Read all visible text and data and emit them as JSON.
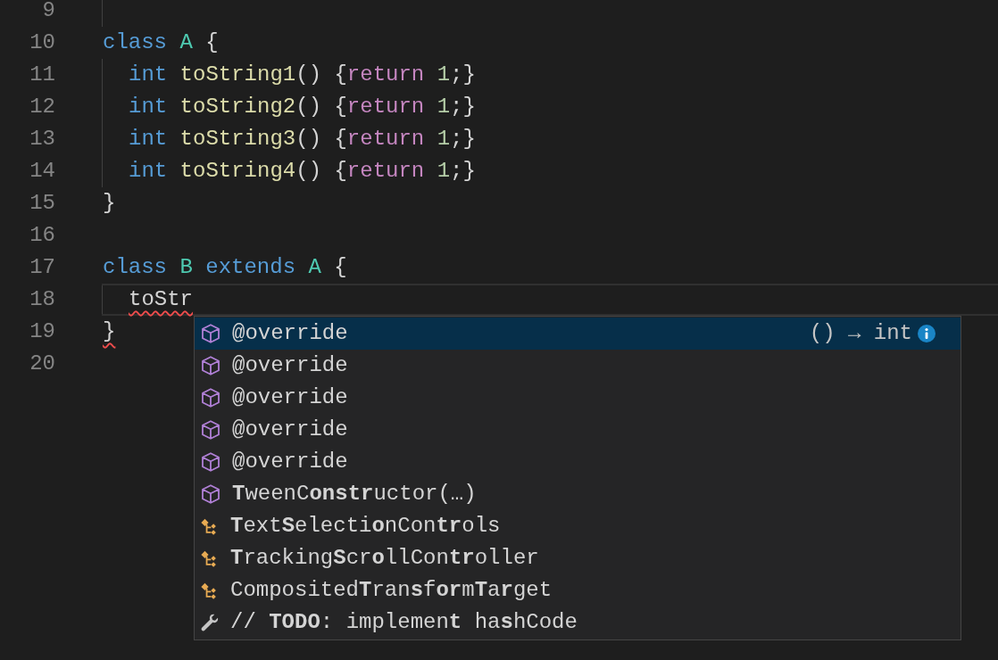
{
  "editor": {
    "lines": [
      {
        "number": "9",
        "guide": true,
        "current": false
      },
      {
        "number": "10",
        "guide": false,
        "current": false,
        "indented": false,
        "tokens": [
          {
            "text": "class ",
            "kind": "keyword"
          },
          {
            "text": "A",
            "kind": "type"
          },
          {
            "text": " {",
            "kind": "plain"
          }
        ]
      },
      {
        "number": "11",
        "guide": true,
        "current": false,
        "indented": true,
        "tokens": [
          {
            "text": "int ",
            "kind": "keyword"
          },
          {
            "text": "toString1",
            "kind": "function"
          },
          {
            "text": "() {",
            "kind": "plain"
          },
          {
            "text": "return ",
            "kind": "control"
          },
          {
            "text": "1",
            "kind": "number"
          },
          {
            "text": ";}",
            "kind": "plain"
          }
        ]
      },
      {
        "number": "12",
        "guide": true,
        "current": false,
        "indented": true,
        "tokens": [
          {
            "text": "int ",
            "kind": "keyword"
          },
          {
            "text": "toString2",
            "kind": "function"
          },
          {
            "text": "() {",
            "kind": "plain"
          },
          {
            "text": "return ",
            "kind": "control"
          },
          {
            "text": "1",
            "kind": "number"
          },
          {
            "text": ";}",
            "kind": "plain"
          }
        ]
      },
      {
        "number": "13",
        "guide": true,
        "current": false,
        "indented": true,
        "tokens": [
          {
            "text": "int ",
            "kind": "keyword"
          },
          {
            "text": "toString3",
            "kind": "function"
          },
          {
            "text": "() {",
            "kind": "plain"
          },
          {
            "text": "return ",
            "kind": "control"
          },
          {
            "text": "1",
            "kind": "number"
          },
          {
            "text": ";}",
            "kind": "plain"
          }
        ]
      },
      {
        "number": "14",
        "guide": true,
        "current": false,
        "indented": true,
        "tokens": [
          {
            "text": "int ",
            "kind": "keyword"
          },
          {
            "text": "toString4",
            "kind": "function"
          },
          {
            "text": "() {",
            "kind": "plain"
          },
          {
            "text": "return ",
            "kind": "control"
          },
          {
            "text": "1",
            "kind": "number"
          },
          {
            "text": ";}",
            "kind": "plain"
          }
        ]
      },
      {
        "number": "15",
        "guide": false,
        "current": false,
        "indented": false,
        "tokens": [
          {
            "text": "}",
            "kind": "plain"
          }
        ]
      },
      {
        "number": "16",
        "guide": false,
        "current": false
      },
      {
        "number": "17",
        "guide": false,
        "current": false,
        "indented": false,
        "tokens": [
          {
            "text": "class ",
            "kind": "keyword"
          },
          {
            "text": "B",
            "kind": "type"
          },
          {
            "text": " extends ",
            "kind": "keyword"
          },
          {
            "text": "A",
            "kind": "type"
          },
          {
            "text": " {",
            "kind": "plain"
          }
        ]
      },
      {
        "number": "18",
        "guide": true,
        "current": true,
        "indented": true,
        "tokens": [
          {
            "text": "toStr",
            "kind": "error"
          }
        ]
      },
      {
        "number": "19",
        "guide": false,
        "current": false,
        "indented": false,
        "tokens": [
          {
            "text": "}",
            "kind": "error"
          }
        ]
      },
      {
        "number": "20",
        "guide": false,
        "current": false
      }
    ]
  },
  "suggestions": {
    "items": [
      {
        "label": "@override",
        "kind": "cube",
        "selected": true,
        "detail": "() → int"
      },
      {
        "label": "@override",
        "kind": "cube",
        "selected": false
      },
      {
        "label": "@override",
        "kind": "cube",
        "selected": false
      },
      {
        "label": "@override",
        "kind": "cube",
        "selected": false
      },
      {
        "label": "@override",
        "kind": "cube",
        "selected": false
      },
      {
        "label": "**T**weenC**onstr**uctor(…)",
        "kind": "cube",
        "selected": false
      },
      {
        "label": "**T**ext**S**electi**o**nCon**tr**ols",
        "kind": "class",
        "selected": false
      },
      {
        "label": "**T**racking**S**cr**o**llCon**tr**oller",
        "kind": "class",
        "selected": false
      },
      {
        "label": "Composited**T**ran**s**f**or**m**T**a**r**get",
        "kind": "class",
        "selected": false
      },
      {
        "label": "// **TODO**: implemen**t** ha**s**hCode",
        "kind": "wrench",
        "selected": false
      }
    ]
  }
}
